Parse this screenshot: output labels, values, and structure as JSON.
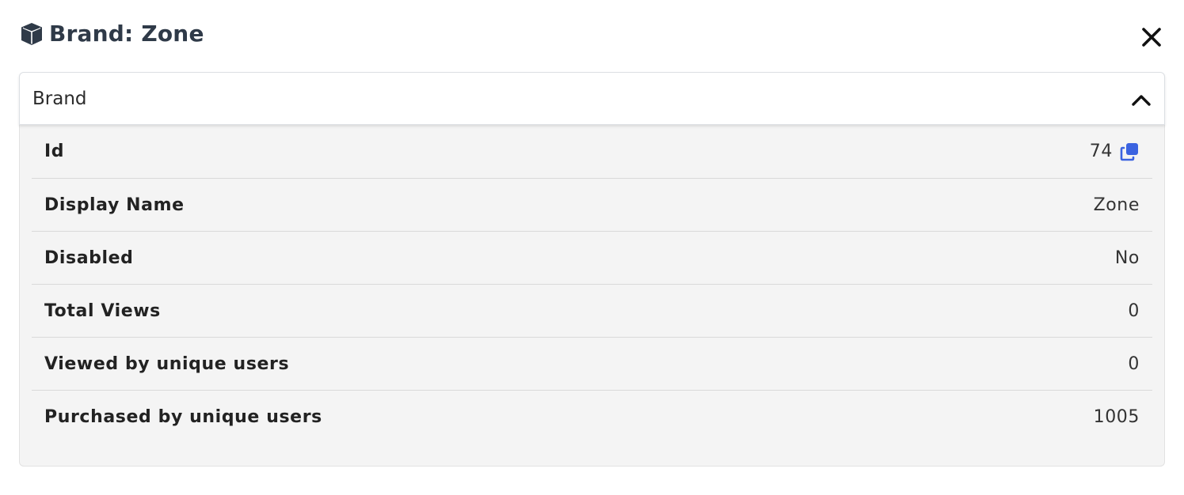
{
  "header": {
    "title": "Brand: Zone",
    "title_icon": "cube-icon",
    "close_icon": "close-icon"
  },
  "accordion": {
    "title": "Brand",
    "expanded": true,
    "toggle_icon": "chevron-up-icon",
    "rows": [
      {
        "label": "Id",
        "value": "74",
        "copyable": true
      },
      {
        "label": "Display Name",
        "value": "Zone"
      },
      {
        "label": "Disabled",
        "value": "No"
      },
      {
        "label": "Total Views",
        "value": "0"
      },
      {
        "label": "Viewed by unique users",
        "value": "0"
      },
      {
        "label": "Purchased by unique users",
        "value": "1005"
      }
    ]
  },
  "colors": {
    "title": "#2f3a48",
    "accent": "#3b63e0",
    "body_bg": "#f4f4f4",
    "divider": "#d9d9d9"
  }
}
